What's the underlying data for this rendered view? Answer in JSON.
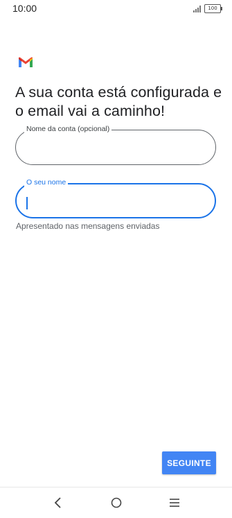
{
  "status_bar": {
    "time": "10:00",
    "battery": "100",
    "icons": [
      "signal-icon",
      "battery-icon"
    ]
  },
  "app": {
    "logo_icon": "gmail-logo-icon",
    "title": "A sua conta está configurada e o email vai a caminho!"
  },
  "fields": {
    "account_name": {
      "label": "Nome da conta (opcional)",
      "value": ""
    },
    "your_name": {
      "label": "O seu nome",
      "value": "",
      "focused": true,
      "helper": "Apresentado nas mensagens enviadas"
    }
  },
  "actions": {
    "next_label": "SEGUINTE"
  },
  "navigation": {
    "icons": [
      "back-icon",
      "home-icon",
      "menu-icon"
    ]
  },
  "colors": {
    "accent": "#1a73e8",
    "button": "#4285f4",
    "text": "#202124",
    "secondary_text": "#5f6368"
  }
}
